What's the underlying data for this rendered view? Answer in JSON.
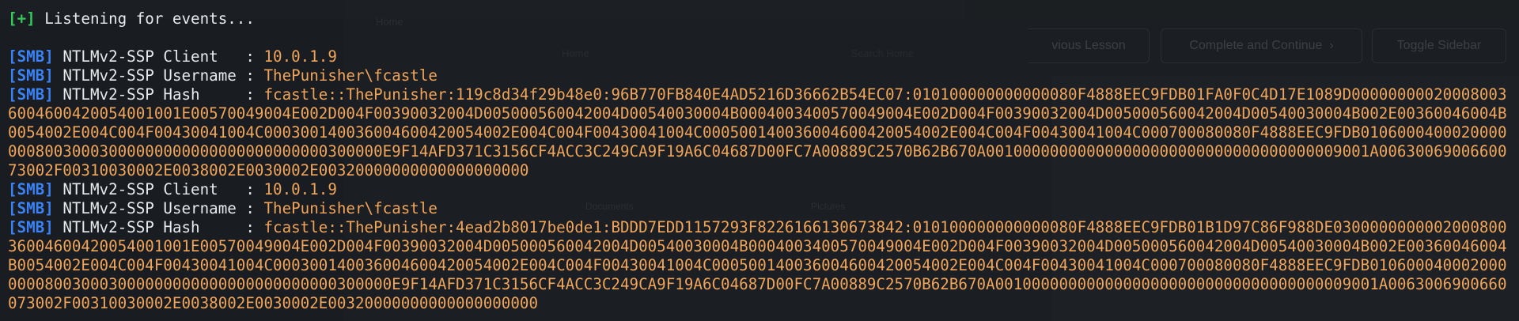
{
  "background": {
    "window_title": "Home",
    "window_crumb": "Home",
    "window_search_placeholder": "Search Home",
    "folder_documents": "Documents",
    "folder_pictures": "Pictures",
    "course_prev_label": "vious Lesson",
    "course_complete_label": "Complete and Continue",
    "course_toggle_label": "Toggle Sidebar"
  },
  "terminal": {
    "status_plus": "[+]",
    "status_text": " Listening for events...",
    "blocks": [
      {
        "client_tag": "[SMB]",
        "client_label": " NTLMv2-SSP Client   : ",
        "client_value": "10.0.1.9",
        "username_tag": "[SMB]",
        "username_label": " NTLMv2-SSP Username : ",
        "username_value": "ThePunisher\\fcastle",
        "hash_tag": "[SMB]",
        "hash_label": " NTLMv2-SSP Hash     : ",
        "hash_value": "fcastle::ThePunisher:119c8d34f29b48e0:96B770FB840E4AD5216D36662B54EC07:010100000000000080F4888EEC9FDB01FA0F0C4D17E1089D000000000200080036004600420054001001E00570049004E002D004F00390032004D005000560042004D00540030004B0004003400570049004E002D004F00390032004D005000560042004D00540030004B002E00360046004B0054002E004C004F00430041004C000300140036004600420054002E004C004F00430041004C000500140036004600420054002E004C004F00430041004C000700080080F4888EEC9FDB010600040002000000080030003000000000000000000000000300000E9F14AFD371C3156CF4ACC3C249CA9F19A6C04687D00FC7A00889C2570B62B670A001000000000000000000000000000000000009001A0063006900660073002F00310030002E0038002E0030002E00320000000000000000000"
      },
      {
        "client_tag": "[SMB]",
        "client_label": " NTLMv2-SSP Client   : ",
        "client_value": "10.0.1.9",
        "username_tag": "[SMB]",
        "username_label": " NTLMv2-SSP Username : ",
        "username_value": "ThePunisher\\fcastle",
        "hash_tag": "[SMB]",
        "hash_label": " NTLMv2-SSP Hash     : ",
        "hash_value": "fcastle::ThePunisher:4ead2b8017be0de1:BDDD7EDD1157293F8226166130673842:010100000000000080F4888EEC9FDB01B1D97C86F988DE030000000000200080036004600420054001001E00570049004E002D004F00390032004D005000560042004D00540030004B0004003400570049004E002D004F00390032004D005000560042004D00540030004B002E00360046004B0054002E004C004F00430041004C000300140036004600420054002E004C004F00430041004C000500140036004600420054002E004C004F00430041004C000700080080F4888EEC9FDB010600040002000000080030003000000000000000000000000300000E9F14AFD371C3156CF4ACC3C249CA9F19A6C04687D00FC7A00889C2570B62B670A001000000000000000000000000000000000009001A0063006900660073002F00310030002E0038002E0030002E00320000000000000000000"
      }
    ]
  }
}
